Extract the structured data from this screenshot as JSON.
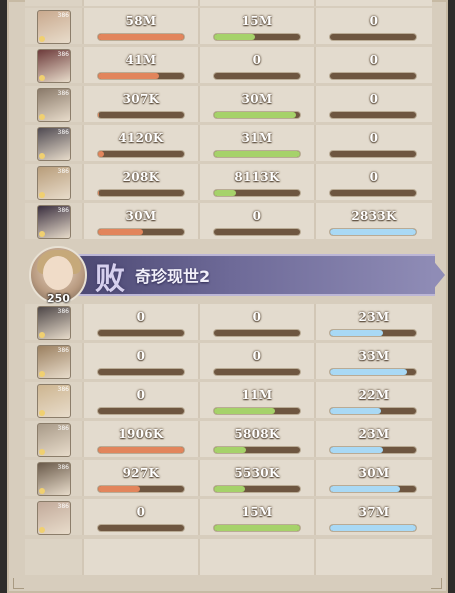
{
  "colors": {
    "panel_bg": "#d7cdbd",
    "cell_bg": "#e3dbce",
    "bar_track": "#6e5640",
    "bar_orange": "#e2855c",
    "bar_green": "#a6d26a",
    "bar_blue": "#a9d9f5",
    "banner_purple": "#6e6a98"
  },
  "team1": {
    "rows": [
      {
        "icon": "character-portrait-icon",
        "level": "386",
        "c1": {
          "value": "58M",
          "fill": 1.0
        },
        "c2": {
          "value": "15M",
          "fill": 0.48
        },
        "c3": {
          "value": "0",
          "fill": 0
        }
      },
      {
        "icon": "character-portrait-icon",
        "level": "386",
        "c1": {
          "value": "41M",
          "fill": 0.71
        },
        "c2": {
          "value": "0",
          "fill": 0
        },
        "c3": {
          "value": "0",
          "fill": 0
        }
      },
      {
        "icon": "character-portrait-icon",
        "level": "386",
        "c1": {
          "value": "307K",
          "fill": 0.01
        },
        "c2": {
          "value": "30M",
          "fill": 0.95
        },
        "c3": {
          "value": "0",
          "fill": 0
        }
      },
      {
        "icon": "character-portrait-icon",
        "level": "386",
        "c1": {
          "value": "4120K",
          "fill": 0.07
        },
        "c2": {
          "value": "31M",
          "fill": 1.0
        },
        "c3": {
          "value": "0",
          "fill": 0
        }
      },
      {
        "icon": "character-portrait-icon",
        "level": "386",
        "c1": {
          "value": "208K",
          "fill": 0.01
        },
        "c2": {
          "value": "8113K",
          "fill": 0.26
        },
        "c3": {
          "value": "0",
          "fill": 0
        }
      },
      {
        "icon": "character-portrait-icon",
        "level": "386",
        "c1": {
          "value": "30M",
          "fill": 0.52
        },
        "c2": {
          "value": "0",
          "fill": 0
        },
        "c3": {
          "value": "2833K",
          "fill": 1.0
        }
      }
    ]
  },
  "team2": {
    "banner": {
      "result": "败",
      "name": "奇珍现世2",
      "level": "250",
      "avatar_icon": "player-avatar-icon"
    },
    "rows": [
      {
        "icon": "character-portrait-icon",
        "level": "386",
        "c1": {
          "value": "0",
          "fill": 0
        },
        "c2": {
          "value": "0",
          "fill": 0
        },
        "c3": {
          "value": "23M",
          "fill": 0.62
        }
      },
      {
        "icon": "character-portrait-icon",
        "level": "386",
        "c1": {
          "value": "0",
          "fill": 0
        },
        "c2": {
          "value": "0",
          "fill": 0
        },
        "c3": {
          "value": "33M",
          "fill": 0.89
        }
      },
      {
        "icon": "character-portrait-icon",
        "level": "386",
        "c1": {
          "value": "0",
          "fill": 0
        },
        "c2": {
          "value": "11M",
          "fill": 0.71
        },
        "c3": {
          "value": "22M",
          "fill": 0.59
        }
      },
      {
        "icon": "character-portrait-icon",
        "level": "386",
        "c1": {
          "value": "1906K",
          "fill": 1.0
        },
        "c2": {
          "value": "5808K",
          "fill": 0.37
        },
        "c3": {
          "value": "23M",
          "fill": 0.62
        }
      },
      {
        "icon": "character-portrait-icon",
        "level": "386",
        "c1": {
          "value": "927K",
          "fill": 0.49
        },
        "c2": {
          "value": "5530K",
          "fill": 0.36
        },
        "c3": {
          "value": "30M",
          "fill": 0.81
        }
      },
      {
        "icon": "character-portrait-icon",
        "level": "386",
        "c1": {
          "value": "0",
          "fill": 0
        },
        "c2": {
          "value": "15M",
          "fill": 1.0
        },
        "c3": {
          "value": "37M",
          "fill": 1.0
        }
      }
    ]
  }
}
